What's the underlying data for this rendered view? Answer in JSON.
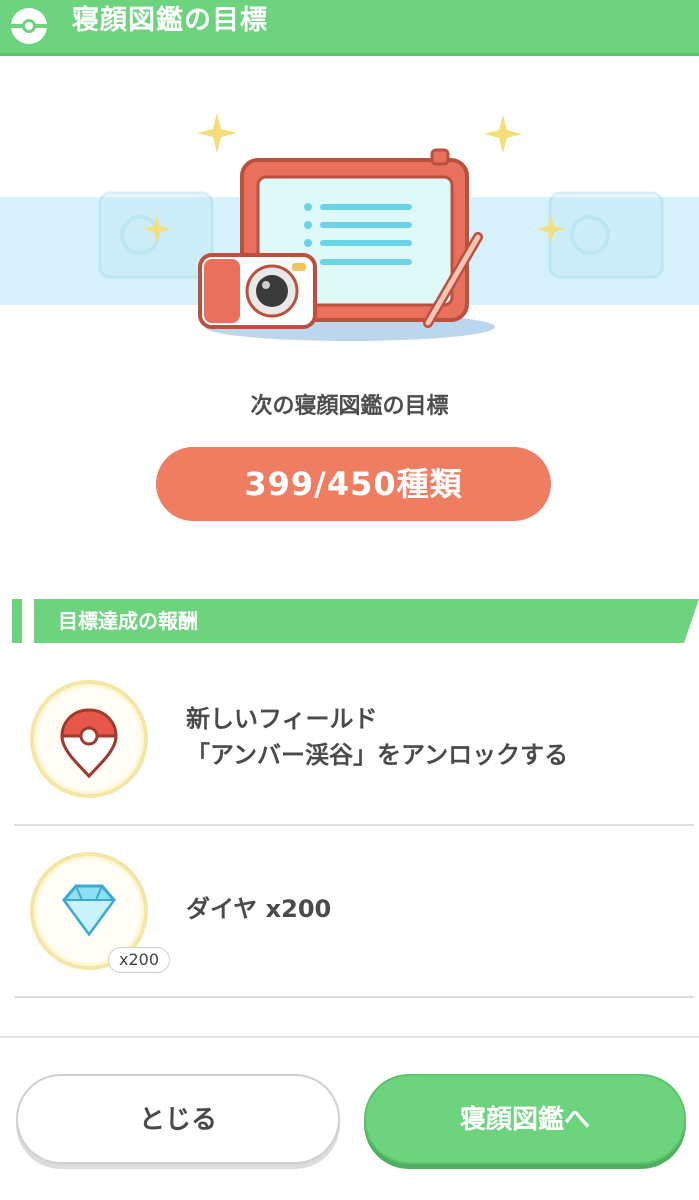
{
  "header": {
    "title": "寝顔図鑑の目標",
    "icon": "pokeball-icon"
  },
  "goal": {
    "caption": "次の寝顔図鑑の目標",
    "progress_text": "399/450種類",
    "current": 399,
    "target": 450
  },
  "rewards_section": {
    "title": "目標達成の報酬"
  },
  "rewards": [
    {
      "line1": "新しいフィールド",
      "line2": "「アンバー渓谷」をアンロックする",
      "icon": "map-pin-icon"
    },
    {
      "text": "ダイヤ x200",
      "badge": "x200",
      "icon": "diamond-icon"
    }
  ],
  "buttons": {
    "close": "とじる",
    "go": "寝顔図鑑へ"
  },
  "colors": {
    "accent_green": "#6ed37e",
    "goal_orange": "#ef7d62",
    "band_blue": "#d6f1fb"
  }
}
